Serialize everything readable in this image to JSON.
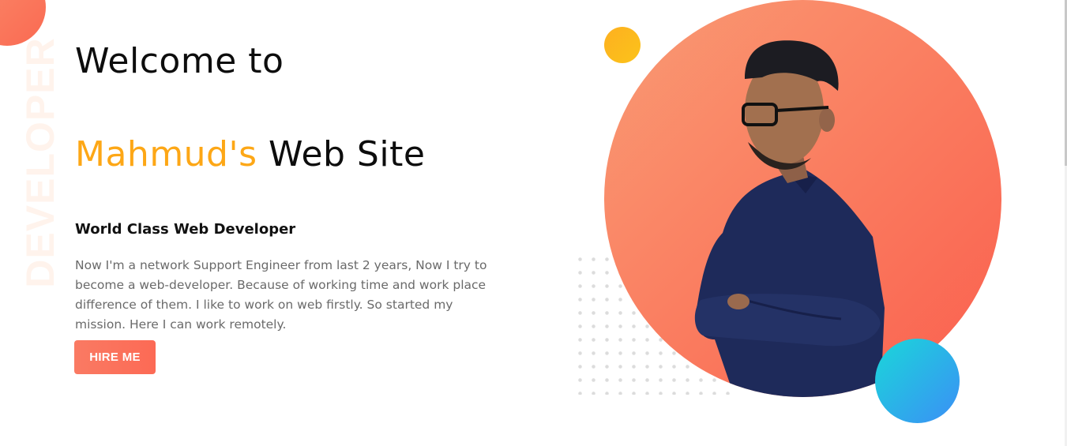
{
  "hero": {
    "side_word": "DEVELOPER",
    "title_line1": "Welcome to",
    "title_name": "Mahmud's",
    "title_rest": "Web Site",
    "subtitle": "World Class Web Developer",
    "description": "Now I'm a network Support Engineer from last 2 years, Now I try to become a web-developer. Because of working time and work place difference of them. I like to work on web firstly. So started my mission. Here I can work remotely.",
    "button_label": "HIRE ME"
  },
  "colors": {
    "accent": "#fda716",
    "button": "#fa7a63",
    "portrait_circle": "#fa7a5e",
    "teal_circle": "#1ad7d9",
    "yellow_circle": "#fdb020"
  }
}
